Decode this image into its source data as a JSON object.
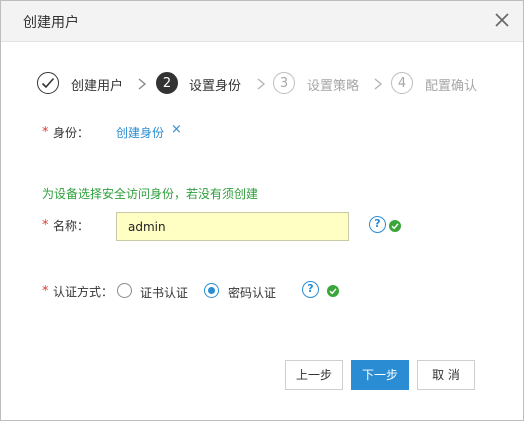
{
  "dialog": {
    "title": "创建用户"
  },
  "steps": [
    {
      "number": "",
      "label": "创建用户",
      "state": "done"
    },
    {
      "number": "2",
      "label": "设置身份",
      "state": "active"
    },
    {
      "number": "3",
      "label": "设置策略",
      "state": "pending"
    },
    {
      "number": "4",
      "label": "配置确认",
      "state": "pending"
    }
  ],
  "form": {
    "required_mark": "*",
    "identity": {
      "label": "身份：",
      "value_link": "创建身份",
      "remove_glyph": "×"
    },
    "hint": "为设备选择安全访问身份，若没有须创建",
    "name": {
      "label": "名称：",
      "value": "admin",
      "help_glyph": "?"
    },
    "auth": {
      "label": "认证方式：",
      "options": [
        "证书认证",
        "密码认证"
      ],
      "selected": "密码认证",
      "help_glyph": "?"
    }
  },
  "buttons": {
    "prev": "上一步",
    "next": "下一步",
    "cancel": "取 消"
  },
  "colors": {
    "accent": "#2a8dd4",
    "success": "#3aa63a",
    "required": "#e0392d",
    "input_bg": "#ffffc4",
    "hint": "#2d9f3b"
  },
  "icons": {
    "close": "close-icon",
    "done_step": "check-icon",
    "step_sep": "chevron-right-icon",
    "help": "question-icon",
    "valid": "check-circle-icon"
  }
}
